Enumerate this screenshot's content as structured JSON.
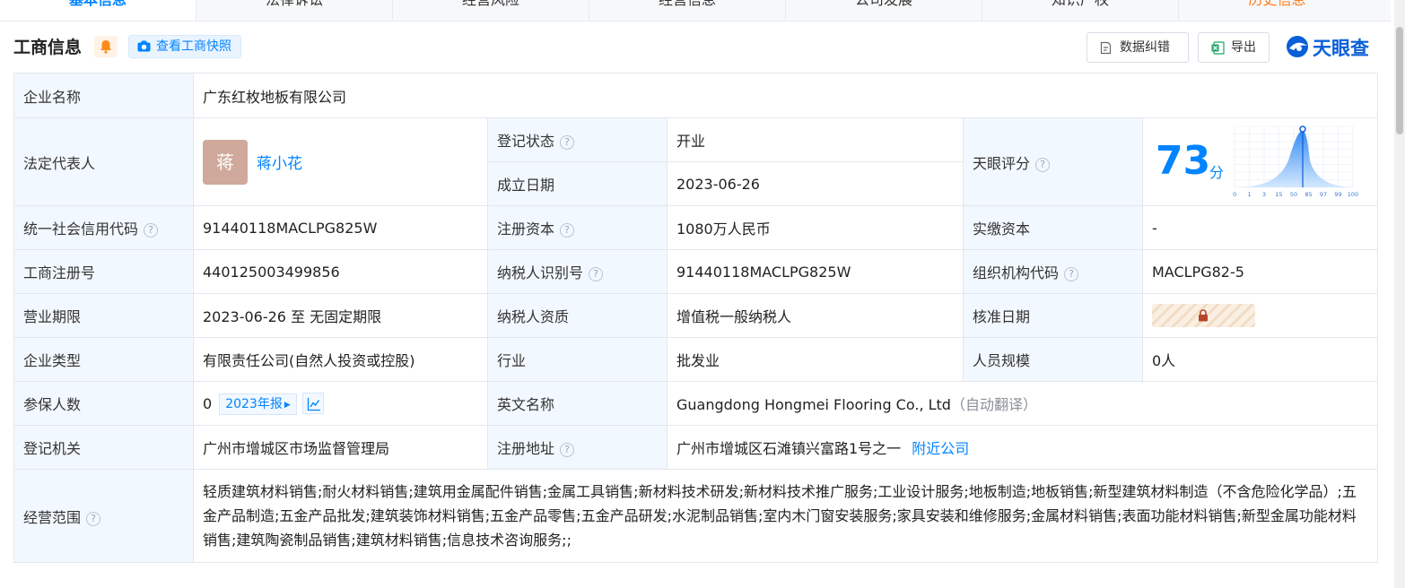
{
  "tabs": [
    {
      "label": "基本信息"
    },
    {
      "label": "法律诉讼"
    },
    {
      "label": "经营风险"
    },
    {
      "label": "经营信息"
    },
    {
      "label": "公司发展"
    },
    {
      "label": "知识产权"
    },
    {
      "label": "历史信息"
    }
  ],
  "header": {
    "title": "工商信息",
    "snapshot_label": "查看工商快照",
    "fix_label": "数据纠错",
    "export_label": "导出",
    "logo_text": "天眼查"
  },
  "colors": {
    "accent": "#0084ff",
    "label_bg": "#f2f8ff",
    "status_green": "#1aa463",
    "orange": "#ff7a1a"
  },
  "info": {
    "company_name_label": "企业名称",
    "company_name": "广东红枚地板有限公司",
    "legal_rep_label": "法定代表人",
    "legal_rep_avatar": "蒋",
    "legal_rep_name": "蒋小花",
    "reg_status_label": "登记状态",
    "reg_status": "开业",
    "found_date_label": "成立日期",
    "found_date": "2023-06-26",
    "score_label": "天眼评分",
    "score": "73",
    "score_unit": "分",
    "credit_code_label": "统一社会信用代码",
    "credit_code": "91440118MACLPG825W",
    "reg_capital_label": "注册资本",
    "reg_capital": "1080万人民币",
    "paid_capital_label": "实缴资本",
    "paid_capital": "-",
    "reg_no_label": "工商注册号",
    "reg_no": "440125003499856",
    "taxpayer_id_label": "纳税人识别号",
    "taxpayer_id": "91440118MACLPG825W",
    "org_code_label": "组织机构代码",
    "org_code": "MACLPG82-5",
    "term_label": "营业期限",
    "term": "2023-06-26 至 无固定期限",
    "taxpayer_qual_label": "纳税人资质",
    "taxpayer_qual": "增值税一般纳税人",
    "approve_date_label": "核准日期",
    "type_label": "企业类型",
    "type": "有限责任公司(自然人投资或控股)",
    "industry_label": "行业",
    "industry": "批发业",
    "staff_size_label": "人员规模",
    "staff_size": "0人",
    "insured_label": "参保人数",
    "insured": "0",
    "insured_year": "2023年报",
    "english_name_label": "英文名称",
    "english_name": "Guangdong Hongmei Flooring Co., Ltd",
    "english_name_note": "（自动翻译）",
    "authority_label": "登记机关",
    "authority": "广州市增城区市场监督管理局",
    "address_label": "注册地址",
    "address": "广州市增城区石滩镇兴富路1号之一",
    "nearby_label": "附近公司",
    "scope_label": "经营范围",
    "scope": "轻质建筑材料销售;耐火材料销售;建筑用金属配件销售;金属工具销售;新材料技术研发;新材料技术推广服务;工业设计服务;地板制造;地板销售;新型建筑材料制造（不含危险化学品）;五金产品制造;五金产品批发;建筑装饰材料销售;五金产品零售;五金产品研发;水泥制品销售;室内木门窗安装服务;家具安装和维修服务;金属材料销售;表面功能材料销售;新型金属功能材料销售;建筑陶瓷制品销售;建筑材料销售;信息技术咨询服务;;"
  },
  "score_chart": {
    "x_ticks": [
      "0",
      "1",
      "3",
      "15",
      "50",
      "85",
      "97",
      "99",
      "100"
    ],
    "marker": "73"
  }
}
